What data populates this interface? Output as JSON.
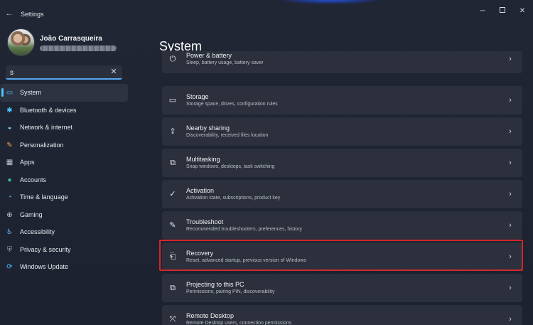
{
  "window": {
    "app_title": "Settings",
    "back_icon": "back-arrow-icon",
    "controls": {
      "minimize": "─",
      "close": "✕"
    }
  },
  "profile": {
    "name": "João Carrasqueira"
  },
  "search": {
    "value": "s",
    "clear_icon": "✕"
  },
  "sidebar": {
    "items": [
      {
        "label": "System",
        "icon": "system-icon",
        "glyph": "▭",
        "color": "#4cc2ff",
        "active": true
      },
      {
        "label": "Bluetooth & devices",
        "icon": "bluetooth-icon",
        "glyph": "✱",
        "color": "#4cc2ff"
      },
      {
        "label": "Network & internet",
        "icon": "wifi-icon",
        "glyph": "◒",
        "color": "#7fd6ff"
      },
      {
        "label": "Personalization",
        "icon": "brush-icon",
        "glyph": "✎",
        "color": "#f2a65a"
      },
      {
        "label": "Apps",
        "icon": "apps-icon",
        "glyph": "▦",
        "color": "#c8ccd4"
      },
      {
        "label": "Accounts",
        "icon": "accounts-icon",
        "glyph": "●",
        "color": "#37c58b"
      },
      {
        "label": "Time & language",
        "icon": "globe-clock-icon",
        "glyph": "◔",
        "color": "#5ab8f5"
      },
      {
        "label": "Gaming",
        "icon": "gamepad-icon",
        "glyph": "⊕",
        "color": "#c8ccd4"
      },
      {
        "label": "Accessibility",
        "icon": "accessibility-icon",
        "glyph": "♿",
        "color": "#5ab8f5"
      },
      {
        "label": "Privacy & security",
        "icon": "shield-icon",
        "glyph": "⛨",
        "color": "#9aa1ad"
      },
      {
        "label": "Windows Update",
        "icon": "update-icon",
        "glyph": "⟳",
        "color": "#4cc2ff"
      }
    ]
  },
  "main": {
    "title": "System",
    "cards": [
      {
        "title": "Power & battery",
        "desc": "Sleep, battery usage, battery saver",
        "icon": "power-icon",
        "glyph": "⏻"
      },
      {
        "title": "Storage",
        "desc": "Storage space, drives, configuration rules",
        "icon": "storage-icon",
        "glyph": "▭"
      },
      {
        "title": "Nearby sharing",
        "desc": "Discoverability, received files location",
        "icon": "share-icon",
        "glyph": "⇪"
      },
      {
        "title": "Multitasking",
        "desc": "Snap windows, desktops, task switching",
        "icon": "multitasking-icon",
        "glyph": "⧉"
      },
      {
        "title": "Activation",
        "desc": "Activation state, subscriptions, product key",
        "icon": "activation-check-icon",
        "glyph": "✓"
      },
      {
        "title": "Troubleshoot",
        "desc": "Recommended troubleshooters, preferences, history",
        "icon": "wrench-icon",
        "glyph": "✎"
      },
      {
        "title": "Recovery",
        "desc": "Reset, advanced startup, previous version of Windows",
        "icon": "recovery-icon",
        "glyph": "⎗",
        "highlighted": true
      },
      {
        "title": "Projecting to this PC",
        "desc": "Permissions, pairing PIN, discoverability",
        "icon": "projector-icon",
        "glyph": "⧉"
      },
      {
        "title": "Remote Desktop",
        "desc": "Remote Desktop users, connection permissions",
        "icon": "remote-desktop-icon",
        "glyph": "⤧"
      }
    ],
    "chevron": "›"
  },
  "colors": {
    "accent": "#4cc2ff",
    "highlight_border": "#d6262b",
    "card_bg": "#2b303c",
    "window_bg": "#202634"
  }
}
